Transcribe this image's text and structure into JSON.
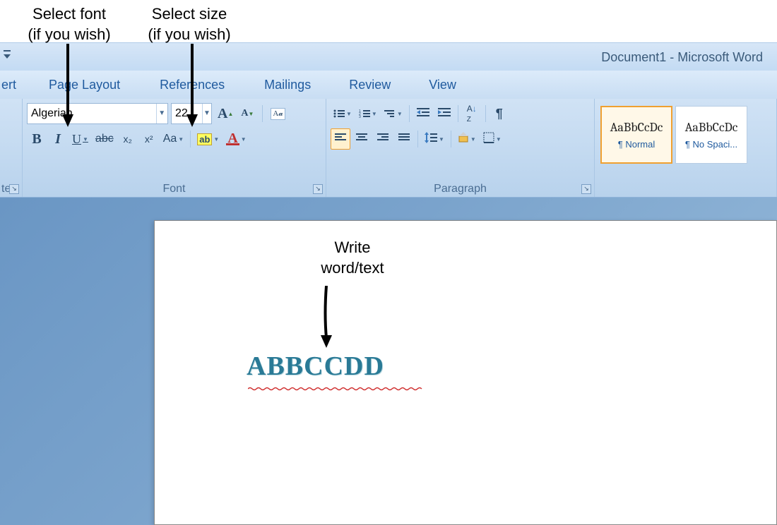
{
  "annotations": {
    "font_label_line1": "Select font",
    "font_label_line2": "(if you wish)",
    "size_label_line1": "Select size",
    "size_label_line2": "(if you wish)",
    "write_label_line1": "Write",
    "write_label_line2": "word/text"
  },
  "titlebar": {
    "document_title": "Document1 - Microsoft Word"
  },
  "menu": {
    "insert_partial": "ert",
    "page_layout": "Page Layout",
    "references": "References",
    "mailings": "Mailings",
    "review": "Review",
    "view": "View"
  },
  "ribbon": {
    "clipboard_partial": "ter",
    "font": {
      "name_value": "Algerian",
      "size_value": "22",
      "grow_label": "A",
      "shrink_label": "A",
      "clear_label": "A🧹",
      "bold": "B",
      "italic": "I",
      "underline": "U",
      "strike": "abc",
      "subscript": "x₂",
      "superscript": "x²",
      "changecase": "Aa",
      "highlight": "ab",
      "fontcolor": "A",
      "group_label": "Font"
    },
    "paragraph": {
      "group_label": "Paragraph",
      "sort": "A↓Z",
      "pilcrow": "¶"
    },
    "styles": {
      "sample": "AaBbCcDc",
      "normal": "¶ Normal",
      "nospacing": "¶ No Spaci..."
    }
  },
  "document": {
    "text": "ABBCCDD"
  }
}
